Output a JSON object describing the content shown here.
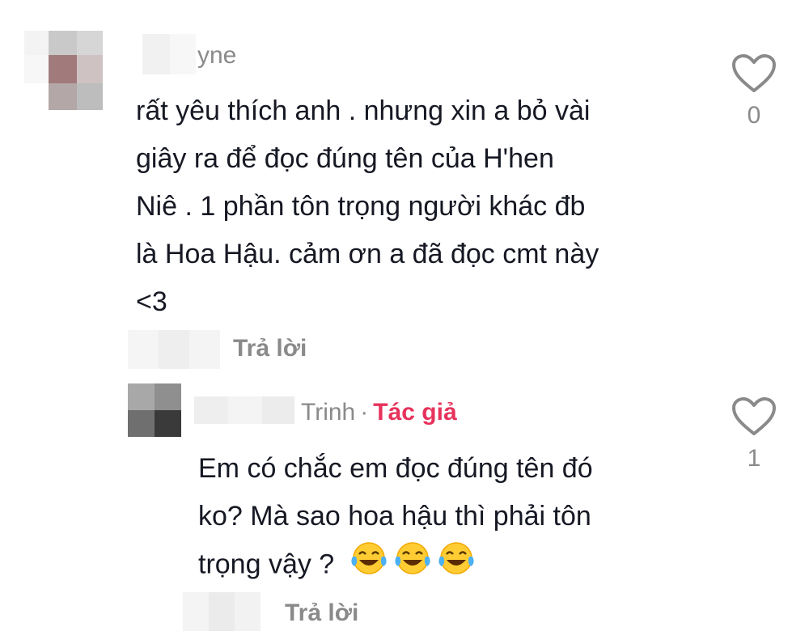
{
  "comment": {
    "username_visible": "yne",
    "text": "rất yêu thích anh . nhưng xin a bỏ vài giây ra để đọc đúng tên của H'hen Niê . 1 phần tôn trọng người khác đb là Hoa Hậu. cảm ơn a đã đọc cmt này <3",
    "text_lines": [
      "rất yêu thích anh . nhưng xin a bỏ vài",
      "giây ra để đọc đúng tên của H'hen",
      "Niê . 1 phần tôn trọng người khác đb",
      "là Hoa Hậu. cảm ơn a đã đọc cmt này",
      "<3"
    ],
    "reply_label": "Trả lời",
    "like_count": "0"
  },
  "reply": {
    "username_visible": "Trinh",
    "separator": "·",
    "author_badge": "Tác giả",
    "text_lines": [
      "Em có chắc em đọc đúng tên đó",
      "ko? Mà sao hoa hậu thì phải tôn",
      "trọng vậy ?"
    ],
    "emojis": [
      "laughing-tears-emoji",
      "laughing-tears-emoji",
      "laughing-tears-emoji"
    ],
    "reply_label": "Trả lời",
    "like_count": "1"
  },
  "colors": {
    "text": "#161823",
    "muted": "#8a8a8a",
    "author_badge": "#e6335c",
    "background": "#ffffff"
  },
  "icons": [
    "heart-outline-icon"
  ]
}
